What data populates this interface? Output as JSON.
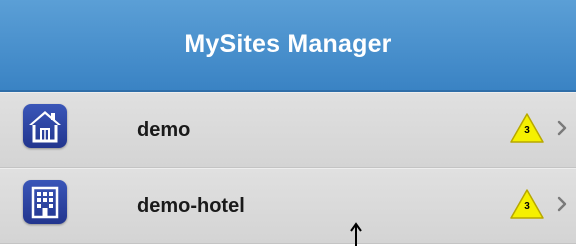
{
  "header": {
    "title": "MySites Manager"
  },
  "sites": [
    {
      "name": "demo",
      "icon": "house-icon",
      "alert_count": "3"
    },
    {
      "name": "demo-hotel",
      "icon": "building-icon",
      "alert_count": "3"
    }
  ],
  "colors": {
    "header_top": "#5b9fd6",
    "header_bottom": "#3a83c4",
    "icon_bg": "#2a42a0",
    "badge_fill": "#f5f000",
    "row_bg": "#d8d8d8"
  }
}
